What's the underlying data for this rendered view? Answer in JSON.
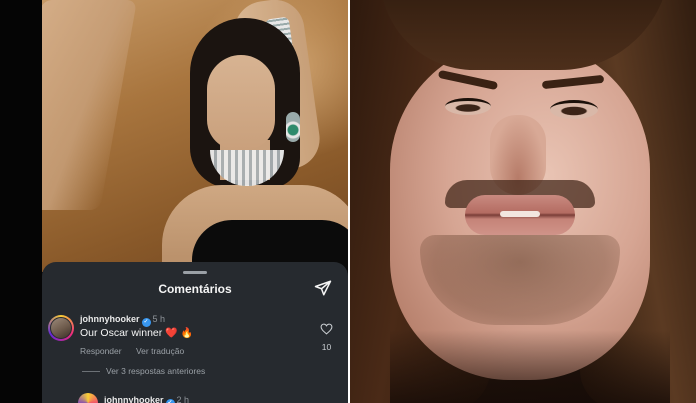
{
  "comments_sheet": {
    "title": "Comentários",
    "comment": {
      "username": "johnnyhooker",
      "time": "5 h",
      "text": "Our Oscar winner",
      "emoji_1": "❤️",
      "emoji_2": "🔥",
      "reply_label": "Responder",
      "translate_label": "Ver tradução",
      "like_count": "10"
    },
    "view_replies_label": "Ver 3 respostas anteriores",
    "reply_preview": {
      "username": "johnnyhooker",
      "time": "2 h"
    }
  },
  "colors": {
    "sheet_background": "#262a2f",
    "verified_badge": "#3897f0",
    "secondary_text": "#9aa0a6"
  },
  "icons": {
    "share": "paper-plane-icon",
    "like": "heart-outline-icon",
    "verified": "verified-badge-icon"
  }
}
